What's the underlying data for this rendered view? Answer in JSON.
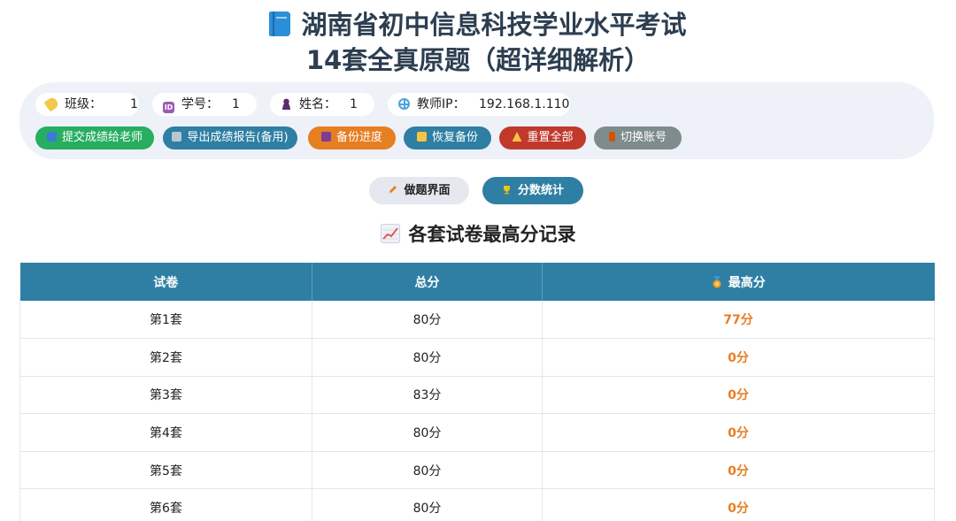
{
  "header": {
    "title_line1": "湖南省初中信息科技学业水平考试",
    "title_line2": "14套全真原题（超详细解析）"
  },
  "info": {
    "class_label": "班级：",
    "class_value": "1",
    "id_label": "学号：",
    "id_value": "1",
    "name_label": "姓名：",
    "name_value": "1",
    "ip_label": "教师IP：",
    "ip_value": "192.168.1.110"
  },
  "toolbar": {
    "submit_label": "提交成绩给老师",
    "export_label": "导出成绩报告(备用)",
    "backup_label": "备份进度",
    "restore_label": "恢复备份",
    "reset_label": "重置全部",
    "switch_label": "切换账号"
  },
  "tabs": {
    "work_label": "做题界面",
    "score_label": "分数统计"
  },
  "section": {
    "title": "各套试卷最高分记录"
  },
  "table": {
    "headers": [
      "试卷",
      "总分",
      "最高分"
    ],
    "rows": [
      {
        "paper": "第1套",
        "total": "80分",
        "best": "77分"
      },
      {
        "paper": "第2套",
        "total": "80分",
        "best": "0分"
      },
      {
        "paper": "第3套",
        "total": "83分",
        "best": "0分"
      },
      {
        "paper": "第4套",
        "total": "80分",
        "best": "0分"
      },
      {
        "paper": "第5套",
        "total": "80分",
        "best": "0分"
      },
      {
        "paper": "第6套",
        "total": "80分",
        "best": "0分"
      }
    ]
  },
  "colors": {
    "accent": "#2e7fa3",
    "title": "#2c3e50",
    "best_score": "#e67e22",
    "green": "#27ae60",
    "orange": "#e67e22",
    "red": "#c0392b",
    "gray": "#7f8c8d"
  },
  "icons": [
    "book-icon",
    "tag-icon",
    "id-icon",
    "user-icon",
    "globe-icon",
    "send-icon",
    "download-icon",
    "save-icon",
    "folder-icon",
    "warning-icon",
    "door-icon",
    "pencil-icon",
    "trophy-icon",
    "chart-icon",
    "medal-icon"
  ]
}
